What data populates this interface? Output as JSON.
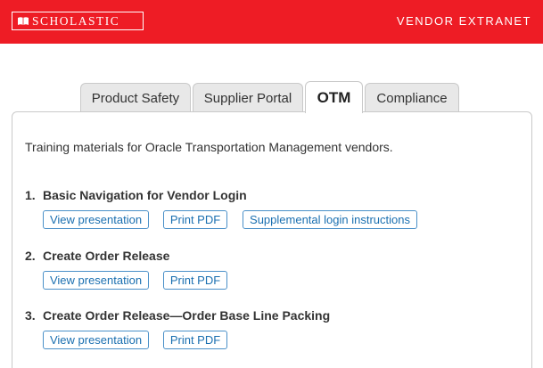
{
  "header": {
    "logo_text": "SCHOLASTIC",
    "title": "VENDOR EXTRANET",
    "brand_color": "#ee1c25"
  },
  "tabs": [
    {
      "label": "Product Safety",
      "active": false
    },
    {
      "label": "Supplier Portal",
      "active": false
    },
    {
      "label": "OTM",
      "active": true
    },
    {
      "label": "Compliance",
      "active": false
    }
  ],
  "panel": {
    "intro": "Training materials for Oracle Transportation Management vendors.",
    "items": [
      {
        "number": "1.",
        "title": "Basic Navigation for Vendor Login",
        "buttons": [
          "View presentation",
          "Print PDF",
          "Supplemental login instructions"
        ]
      },
      {
        "number": "2.",
        "title": "Create Order Release",
        "buttons": [
          "View presentation",
          "Print PDF"
        ]
      },
      {
        "number": "3.",
        "title": "Create Order Release—Order Base Line Packing",
        "buttons": [
          "View presentation",
          "Print PDF"
        ]
      }
    ]
  }
}
